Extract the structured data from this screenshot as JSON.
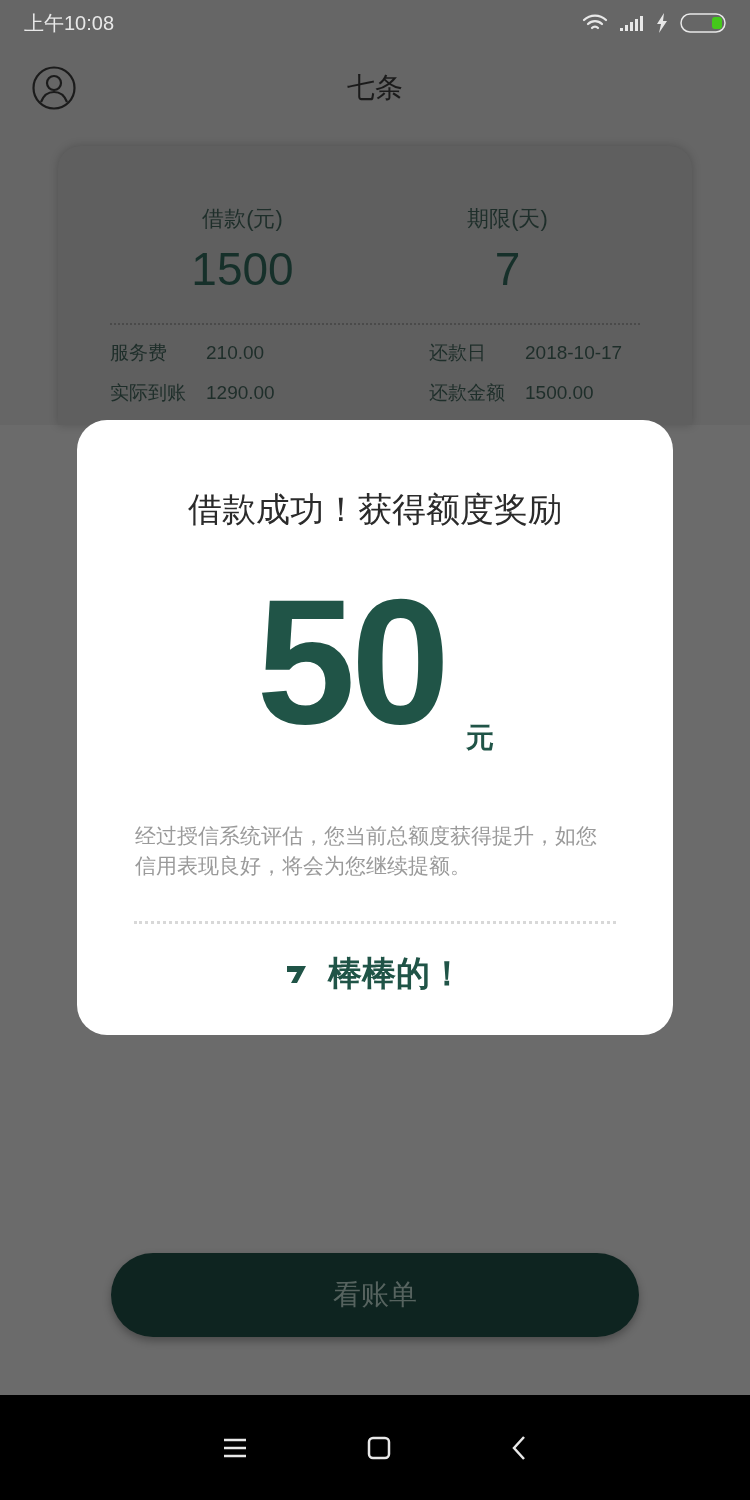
{
  "status_bar": {
    "time": "上午10:08"
  },
  "header": {
    "title": "七条"
  },
  "loan_card": {
    "stats": [
      {
        "label": "借款(元)",
        "value": "1500"
      },
      {
        "label": "期限(天)",
        "value": "7"
      }
    ],
    "details": [
      {
        "label": "服务费",
        "value": "210.00"
      },
      {
        "label": "还款日",
        "value": "2018-10-17"
      },
      {
        "label": "实际到账",
        "value": "1290.00"
      },
      {
        "label": "还款金额",
        "value": "1500.00"
      }
    ]
  },
  "dialog": {
    "title": "借款成功！获得额度奖励",
    "amount": "50",
    "unit": "元",
    "message": "经过授信系统评估，您当前总额度获得提升，如您信用表现良好，将会为您继续提额。",
    "button": "棒棒的！"
  },
  "bill_button": "看账单"
}
